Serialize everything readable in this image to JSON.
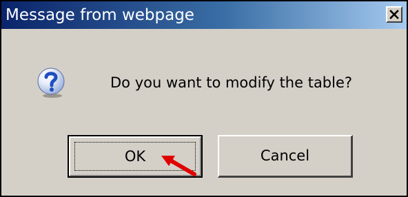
{
  "dialog": {
    "title": "Message from webpage",
    "message": "Do you want to modify the table?",
    "icon": "question-icon",
    "close_icon": "close-icon",
    "buttons": {
      "ok_label": "OK",
      "cancel_label": "Cancel"
    },
    "focused_button": "OK",
    "annotation": "red-arrow-icon pointing at OK button"
  },
  "colors": {
    "titlebar_start": "#0a246a",
    "titlebar_end": "#a6caf0",
    "dialog_background": "#d4d0c8",
    "arrow": "#e00000",
    "icon_blue": "#1f4fbf"
  }
}
